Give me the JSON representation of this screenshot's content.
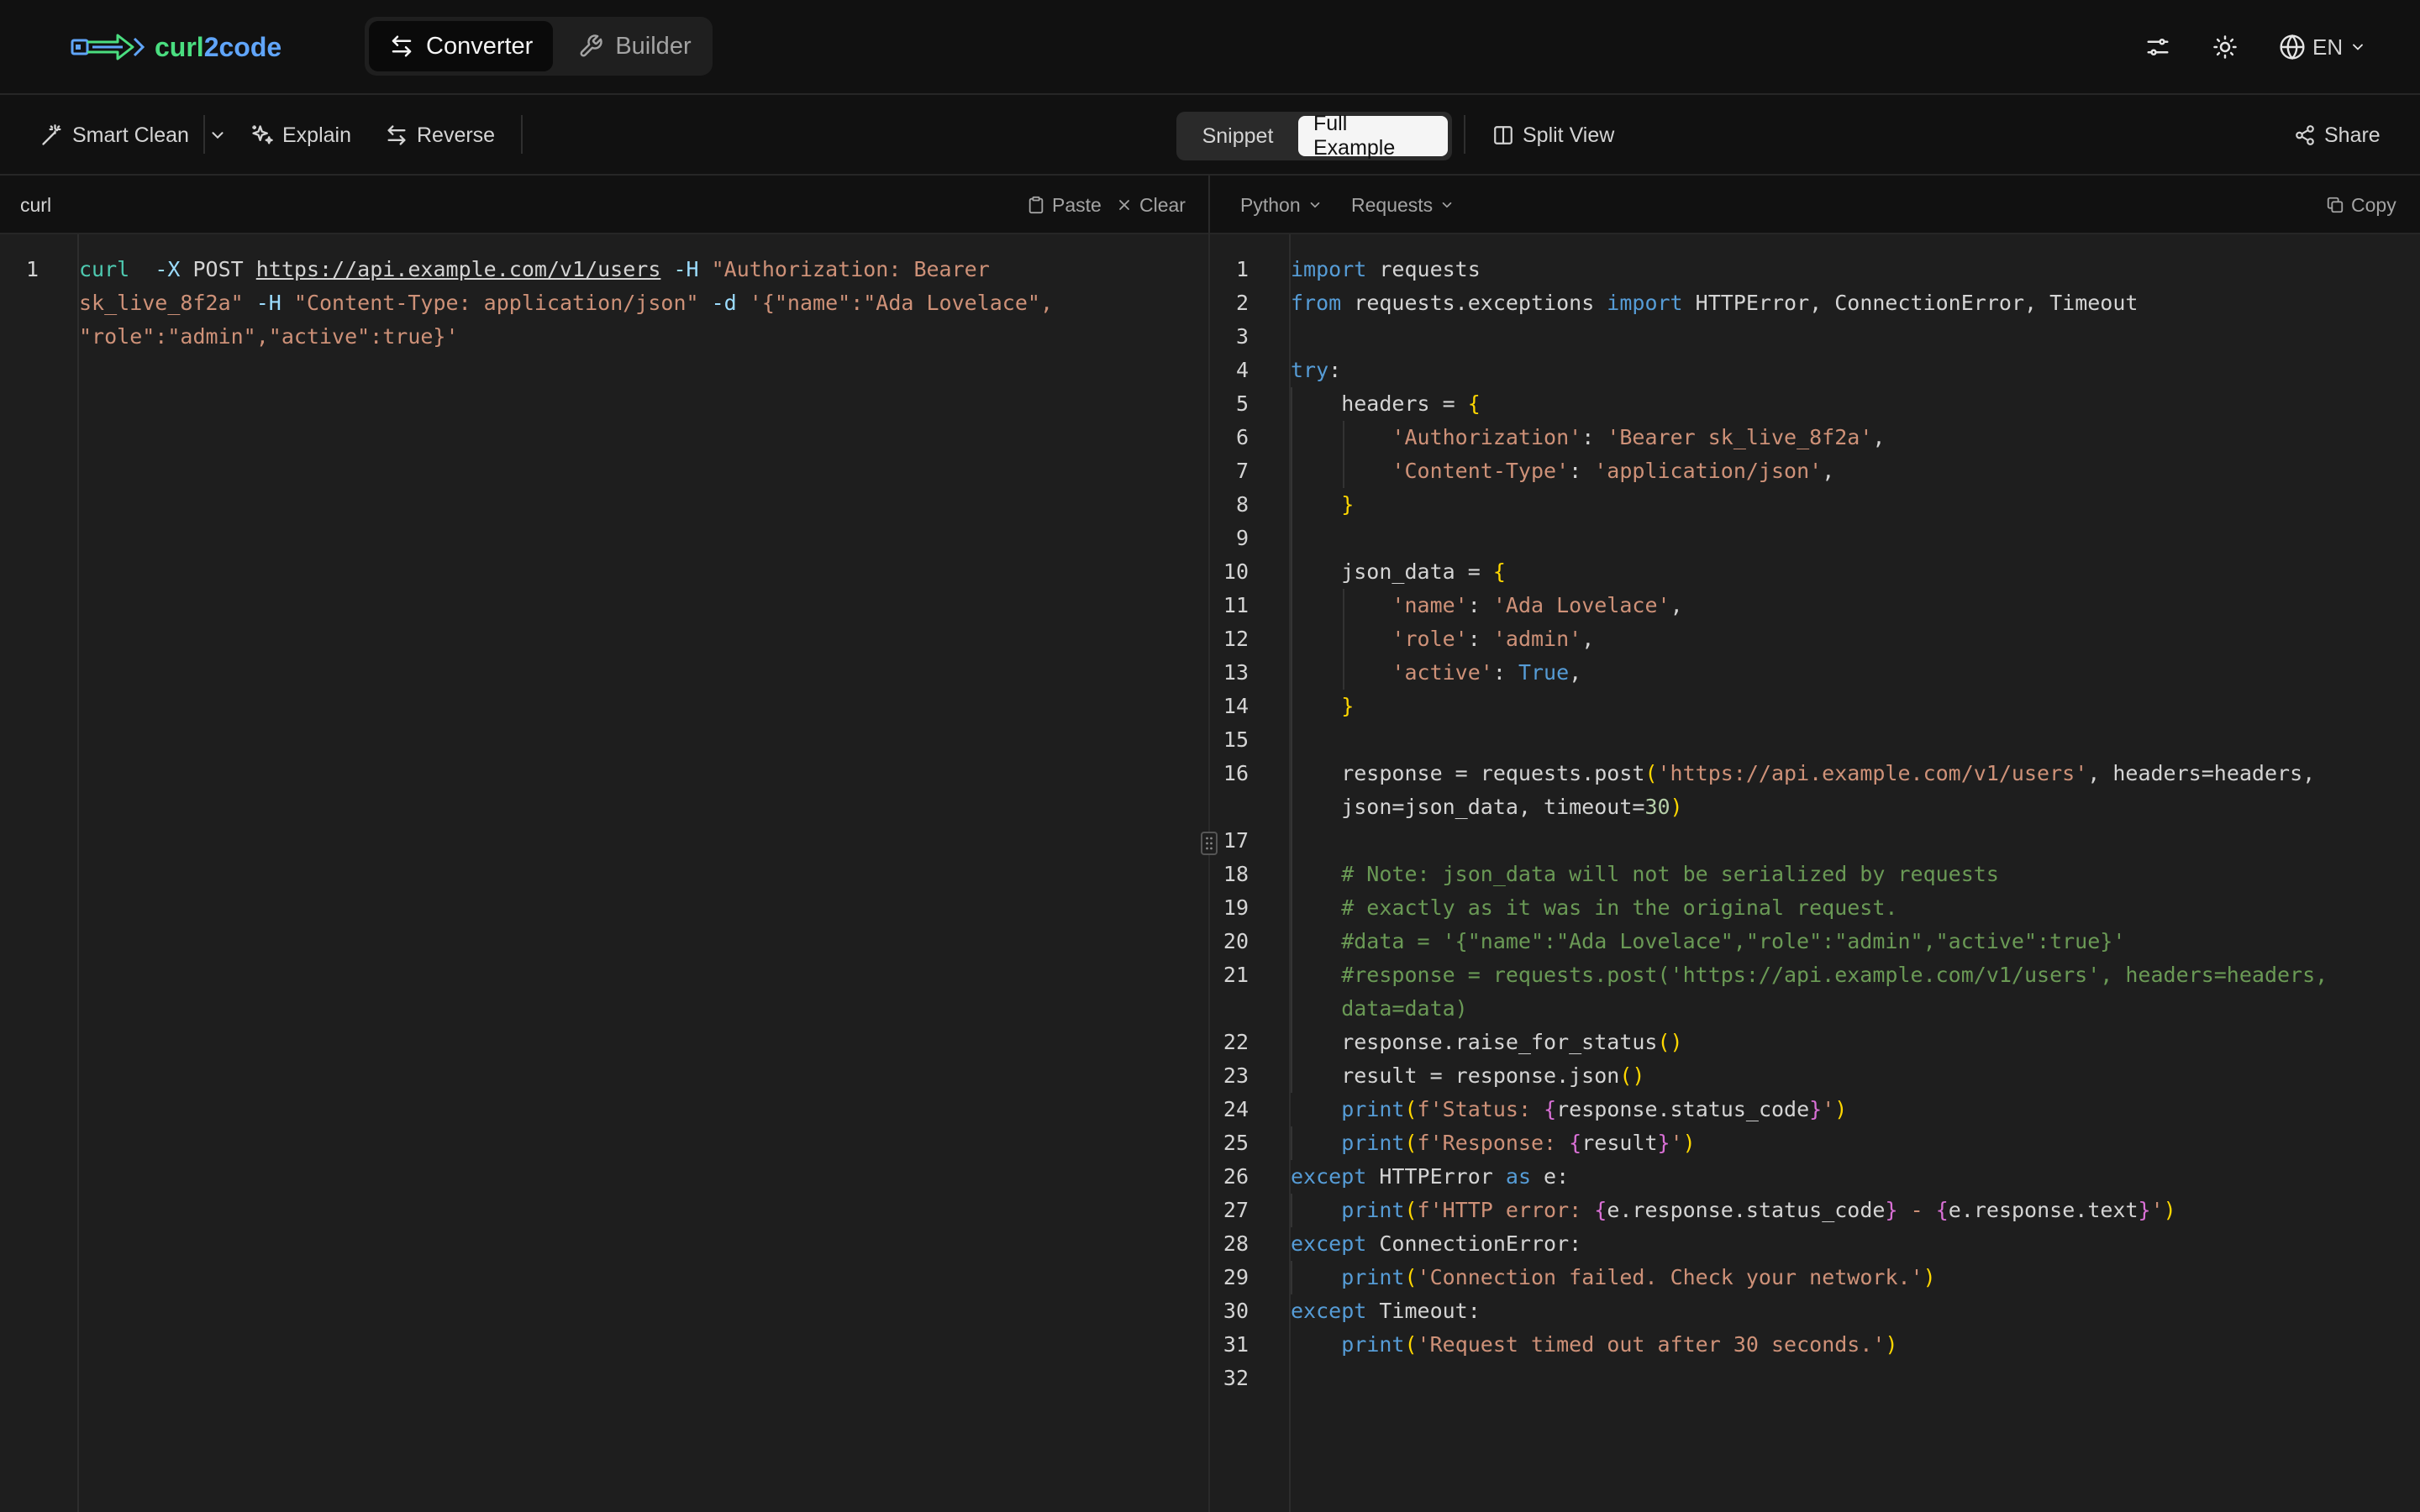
{
  "app": {
    "logo_part1": "curl",
    "logo_part2": "2code"
  },
  "modes": [
    {
      "label": "Converter",
      "active": true
    },
    {
      "label": "Builder",
      "active": false
    }
  ],
  "topbar": {
    "language": "EN"
  },
  "toolbar": {
    "smart_clean": "Smart Clean",
    "explain": "Explain",
    "reverse": "Reverse",
    "snippet": "Snippet",
    "full_example": "Full Example",
    "split_view": "Split View",
    "share": "Share"
  },
  "input_panel": {
    "label": "curl",
    "paste": "Paste",
    "clear": "Clear",
    "line_numbers": [
      "1"
    ]
  },
  "output_panel": {
    "language": "Python",
    "library": "Requests",
    "copy": "Copy",
    "line_numbers": [
      "1",
      "2",
      "3",
      "4",
      "5",
      "6",
      "7",
      "8",
      "9",
      "10",
      "11",
      "12",
      "13",
      "14",
      "15",
      "16",
      "17",
      "18",
      "19",
      "20",
      "21",
      "22",
      "23",
      "24",
      "25",
      "26",
      "27",
      "28",
      "29",
      "30",
      "31",
      "32"
    ]
  },
  "curl_input": [
    [
      [
        "fl",
        "curl"
      ],
      [
        "",
        "  "
      ],
      [
        "op",
        "-X"
      ],
      [
        "",
        " POST "
      ],
      [
        "u",
        "https://api.example.com/v1/users"
      ],
      [
        "",
        " "
      ],
      [
        "op",
        "-H"
      ],
      [
        "",
        " "
      ],
      [
        "s",
        "\"Authorization: Bearer"
      ]
    ],
    [
      [
        "s",
        "sk_live_8f2a\""
      ],
      [
        "",
        " "
      ],
      [
        "op",
        "-H"
      ],
      [
        "",
        " "
      ],
      [
        "s",
        "\"Content-Type: application/json\""
      ],
      [
        "",
        " "
      ],
      [
        "op",
        "-d"
      ],
      [
        "",
        " "
      ],
      [
        "s",
        "'{\"name\":\"Ada Lovelace\","
      ]
    ],
    [
      [
        "s",
        "\"role\":\"admin\",\"active\":true}'"
      ]
    ]
  ],
  "python_output": [
    {
      "ln": "1",
      "segs": [
        [
          "k",
          "import"
        ],
        [
          "",
          " requests"
        ]
      ]
    },
    {
      "ln": "2",
      "segs": [
        [
          "k",
          "from"
        ],
        [
          "",
          " requests.exceptions "
        ],
        [
          "k",
          "import"
        ],
        [
          "",
          " HTTPError, ConnectionError, Timeout"
        ]
      ]
    },
    {
      "ln": "3",
      "segs": []
    },
    {
      "ln": "4",
      "segs": [
        [
          "k",
          "try"
        ],
        [
          "",
          ":"
        ]
      ]
    },
    {
      "ln": "5",
      "segs": [
        [
          "",
          "    headers = "
        ],
        [
          "y",
          "{"
        ]
      ]
    },
    {
      "ln": "6",
      "segs": [
        [
          "",
          "        "
        ],
        [
          "s",
          "'Authorization'"
        ],
        [
          "",
          ": "
        ],
        [
          "s",
          "'Bearer sk_live_8f2a'"
        ],
        [
          "",
          ","
        ]
      ]
    },
    {
      "ln": "7",
      "segs": [
        [
          "",
          "        "
        ],
        [
          "s",
          "'Content-Type'"
        ],
        [
          "",
          ": "
        ],
        [
          "s",
          "'application/json'"
        ],
        [
          "",
          ","
        ]
      ]
    },
    {
      "ln": "8",
      "segs": [
        [
          "",
          "    "
        ],
        [
          "y",
          "}"
        ]
      ]
    },
    {
      "ln": "9",
      "segs": []
    },
    {
      "ln": "10",
      "segs": [
        [
          "",
          "    json_data = "
        ],
        [
          "y",
          "{"
        ]
      ]
    },
    {
      "ln": "11",
      "segs": [
        [
          "",
          "        "
        ],
        [
          "s",
          "'name'"
        ],
        [
          "",
          ": "
        ],
        [
          "s",
          "'Ada Lovelace'"
        ],
        [
          "",
          ","
        ]
      ]
    },
    {
      "ln": "12",
      "segs": [
        [
          "",
          "        "
        ],
        [
          "s",
          "'role'"
        ],
        [
          "",
          ": "
        ],
        [
          "s",
          "'admin'"
        ],
        [
          "",
          ","
        ]
      ]
    },
    {
      "ln": "13",
      "segs": [
        [
          "",
          "        "
        ],
        [
          "s",
          "'active'"
        ],
        [
          "",
          ": "
        ],
        [
          "k",
          "True"
        ],
        [
          "",
          ","
        ]
      ]
    },
    {
      "ln": "14",
      "segs": [
        [
          "",
          "    "
        ],
        [
          "y",
          "}"
        ]
      ]
    },
    {
      "ln": "15",
      "segs": []
    },
    {
      "ln": "16",
      "segs": [
        [
          "",
          "    response = requests.post"
        ],
        [
          "y",
          "("
        ],
        [
          "s",
          "'https://api.example.com/v1/users'"
        ],
        [
          "",
          ", headers=headers,"
        ]
      ]
    },
    {
      "ln": "",
      "segs": [
        [
          "",
          "    json=json_data, timeout="
        ],
        [
          "n",
          "30"
        ],
        [
          "y",
          ")"
        ]
      ]
    },
    {
      "ln": "17",
      "segs": []
    },
    {
      "ln": "18",
      "segs": [
        [
          "c",
          "    # Note: json_data will not be serialized by requests"
        ]
      ]
    },
    {
      "ln": "19",
      "segs": [
        [
          "c",
          "    # exactly as it was in the original request."
        ]
      ]
    },
    {
      "ln": "20",
      "segs": [
        [
          "c",
          "    #data = '{\"name\":\"Ada Lovelace\",\"role\":\"admin\",\"active\":true}'"
        ]
      ]
    },
    {
      "ln": "21",
      "segs": [
        [
          "c",
          "    #response = requests.post('https://api.example.com/v1/users', headers=headers,"
        ]
      ]
    },
    {
      "ln": "",
      "segs": [
        [
          "c",
          "    data=data)"
        ]
      ]
    },
    {
      "ln": "22",
      "segs": [
        [
          "",
          "    response.raise_for_status"
        ],
        [
          "y",
          "()"
        ]
      ]
    },
    {
      "ln": "23",
      "segs": [
        [
          "",
          "    result = response.json"
        ],
        [
          "y",
          "()"
        ]
      ]
    },
    {
      "ln": "24",
      "segs": [
        [
          "",
          "    "
        ],
        [
          "bt",
          "print"
        ],
        [
          "y",
          "("
        ],
        [
          "s",
          "f'Status: "
        ],
        [
          "p",
          "{"
        ],
        [
          "",
          "response.status_code"
        ],
        [
          "p",
          "}"
        ],
        [
          "s",
          "'"
        ],
        [
          "y",
          ")"
        ]
      ]
    },
    {
      "ln": "25",
      "segs": [
        [
          "",
          "    "
        ],
        [
          "bt",
          "print"
        ],
        [
          "y",
          "("
        ],
        [
          "s",
          "f'Response: "
        ],
        [
          "p",
          "{"
        ],
        [
          "",
          "result"
        ],
        [
          "p",
          "}"
        ],
        [
          "s",
          "'"
        ],
        [
          "y",
          ")"
        ]
      ]
    },
    {
      "ln": "26",
      "segs": [
        [
          "k",
          "except"
        ],
        [
          "",
          " HTTPError "
        ],
        [
          "k",
          "as"
        ],
        [
          "",
          " e:"
        ]
      ]
    },
    {
      "ln": "27",
      "segs": [
        [
          "",
          "    "
        ],
        [
          "bt",
          "print"
        ],
        [
          "y",
          "("
        ],
        [
          "s",
          "f'HTTP error: "
        ],
        [
          "p",
          "{"
        ],
        [
          "",
          "e.response.status_code"
        ],
        [
          "p",
          "}"
        ],
        [
          "s",
          " - "
        ],
        [
          "p",
          "{"
        ],
        [
          "",
          "e.response.text"
        ],
        [
          "p",
          "}"
        ],
        [
          "s",
          "'"
        ],
        [
          "y",
          ")"
        ]
      ]
    },
    {
      "ln": "28",
      "segs": [
        [
          "k",
          "except"
        ],
        [
          "",
          " ConnectionError:"
        ]
      ]
    },
    {
      "ln": "29",
      "segs": [
        [
          "",
          "    "
        ],
        [
          "bt",
          "print"
        ],
        [
          "y",
          "("
        ],
        [
          "s",
          "'Connection failed. Check your network.'"
        ],
        [
          "y",
          ")"
        ]
      ]
    },
    {
      "ln": "30",
      "segs": [
        [
          "k",
          "except"
        ],
        [
          "",
          " Timeout:"
        ]
      ]
    },
    {
      "ln": "31",
      "segs": [
        [
          "",
          "    "
        ],
        [
          "bt",
          "print"
        ],
        [
          "y",
          "("
        ],
        [
          "s",
          "'Request timed out after 30 seconds.'"
        ],
        [
          "y",
          ")"
        ]
      ]
    },
    {
      "ln": "32",
      "segs": []
    }
  ]
}
